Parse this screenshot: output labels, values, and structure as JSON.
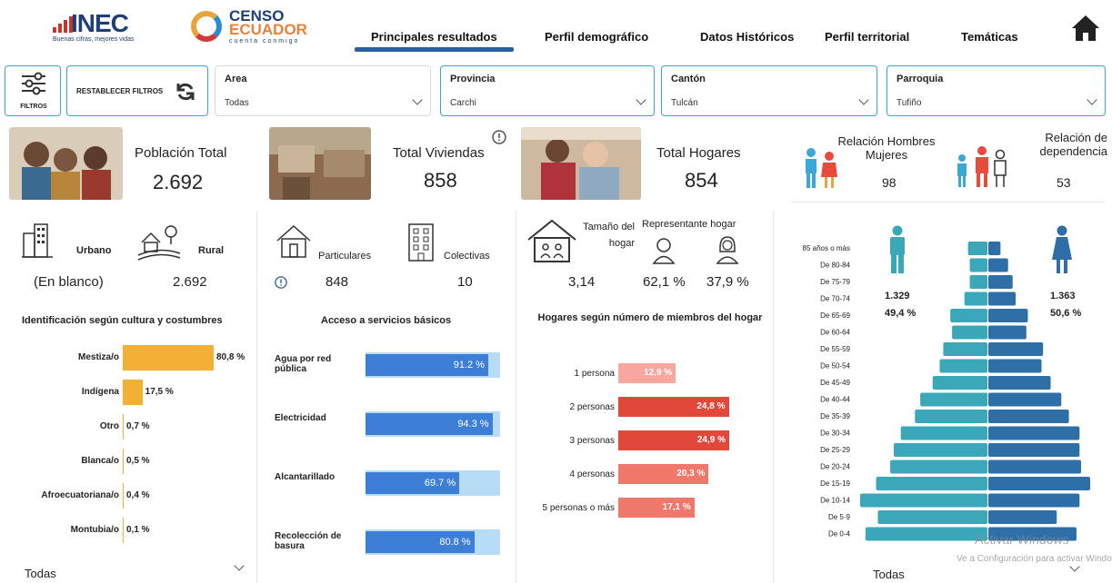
{
  "header": {
    "inec_logo": "INEC",
    "inec_tagline": "Buenas cifras, mejores vidas",
    "censo_line1": "CENSO",
    "censo_line2": "ECUADOR",
    "censo_tagline": "cuenta conmigo",
    "nav": [
      "Principales resultados",
      "Perfil demográfico",
      "Datos Históricos",
      "Perfil territorial",
      "Temáticas"
    ],
    "active_tab": "Principales resultados"
  },
  "filters": {
    "filtros_label": "FILTROS",
    "reset_label": "RESTABLECER FILTROS",
    "area": {
      "label": "Area",
      "value": "Todas"
    },
    "provincia": {
      "label": "Provincia",
      "value": "Carchi"
    },
    "canton": {
      "label": "Cantón",
      "value": "Tulcán"
    },
    "parroquia": {
      "label": "Parroquia",
      "value": "Tufiño"
    }
  },
  "kpis": {
    "poblacion_label": "Población Total",
    "poblacion_value": "2.692",
    "viviendas_label": "Total Viviendas",
    "viviendas_value": "858",
    "hogares_label": "Total Hogares",
    "hogares_value": "854",
    "relacion_hm_label": "Relación Hombres Mujeres",
    "relacion_hm_value": "98",
    "dependencia_label": "Relación de dependencia",
    "dependencia_value": "53"
  },
  "area_split": {
    "urbano_label": "Urbano",
    "urbano_value": "(En blanco)",
    "rural_label": "Rural",
    "rural_value": "2.692"
  },
  "viviendas": {
    "particulares_label": "Particulares",
    "particulares_value": "848",
    "colectivas_label": "Colectivas",
    "colectivas_value": "10"
  },
  "hogar": {
    "tamano_label": "Tamaño del hogar",
    "tamano_value": "3,14",
    "representante_label": "Representante hogar",
    "rep_hombre": "62,1 %",
    "rep_mujer": "37,9 %"
  },
  "cultura": {
    "title": "Identificación según cultura y costumbres",
    "color": "#f2b134",
    "items": [
      {
        "label": "Mestiza/o",
        "value": 80.8,
        "text": "80,8 %"
      },
      {
        "label": "Indígena",
        "value": 17.5,
        "text": "17,5 %"
      },
      {
        "label": "Otro",
        "value": 0.7,
        "text": "0,7 %"
      },
      {
        "label": "Blanca/o",
        "value": 0.5,
        "text": "0,5 %"
      },
      {
        "label": "Afroecuatoriana/o",
        "value": 0.4,
        "text": "0,4 %"
      },
      {
        "label": "Montubia/o",
        "value": 0.1,
        "text": "0,1 %"
      }
    ],
    "slicer": "Todas"
  },
  "servicios": {
    "title": "Acceso a servicios básicos",
    "items": [
      {
        "label": "Agua por red pública",
        "value": 91.2,
        "text": "91.2 %"
      },
      {
        "label": "Electricidad",
        "value": 94.3,
        "text": "94.3 %"
      },
      {
        "label": "Alcantarillado",
        "value": 69.7,
        "text": "69.7 %"
      },
      {
        "label": "Recolección de basura",
        "value": 80.8,
        "text": "80.8 %"
      }
    ]
  },
  "miembros": {
    "title": "Hogares según número de miembros del hogar",
    "items": [
      {
        "label": "1 persona",
        "value": 12.9,
        "text": "12,9 %",
        "color": "#f7a79d"
      },
      {
        "label": "2 personas",
        "value": 24.8,
        "text": "24,8 %",
        "color": "#e2483a"
      },
      {
        "label": "3 personas",
        "value": 24.9,
        "text": "24,9 %",
        "color": "#e2483a"
      },
      {
        "label": "4 personas",
        "value": 20.3,
        "text": "20,3 %",
        "color": "#f0786a"
      },
      {
        "label": "5 personas o más",
        "value": 17.1,
        "text": "17,1 %",
        "color": "#f0786a"
      }
    ]
  },
  "piramide": {
    "hombres_value": "1.329",
    "hombres_pct": "49,4 %",
    "mujeres_value": "1.363",
    "mujeres_pct": "50,6 %",
    "slicer": "Todas",
    "watermark": "Activar Windows",
    "watermark2": "Ve a Configuración para activar Windows."
  },
  "chart_data": {
    "type": "bar",
    "orientation": "horizontal-pyramid",
    "categories": [
      "85 años o más",
      "De 80-84",
      "De 75-79",
      "De 70-74",
      "De 65-69",
      "De 60-64",
      "De 55-59",
      "De 50-54",
      "De 45-49",
      "De 40-44",
      "De 35-39",
      "De 30-34",
      "De 25-29",
      "De 20-24",
      "De 15-19",
      "De 10-14",
      "De 5-9",
      "De 0-4"
    ],
    "series": [
      {
        "name": "Hombres",
        "color": "#3aa8b8",
        "values": [
          1.1,
          1.0,
          1.0,
          1.3,
          2.1,
          2.0,
          2.5,
          2.7,
          3.1,
          3.8,
          4.1,
          4.9,
          5.3,
          5.5,
          6.3,
          7.2,
          6.2,
          6.9
        ]
      },
      {
        "name": "Mujeres",
        "color": "#2e6fa8",
        "values": [
          0.8,
          1.3,
          1.6,
          1.8,
          2.6,
          2.5,
          3.6,
          3.5,
          4.1,
          4.8,
          5.3,
          6.0,
          6.0,
          6.1,
          6.7,
          6.0,
          4.5,
          5.8
        ]
      }
    ]
  }
}
